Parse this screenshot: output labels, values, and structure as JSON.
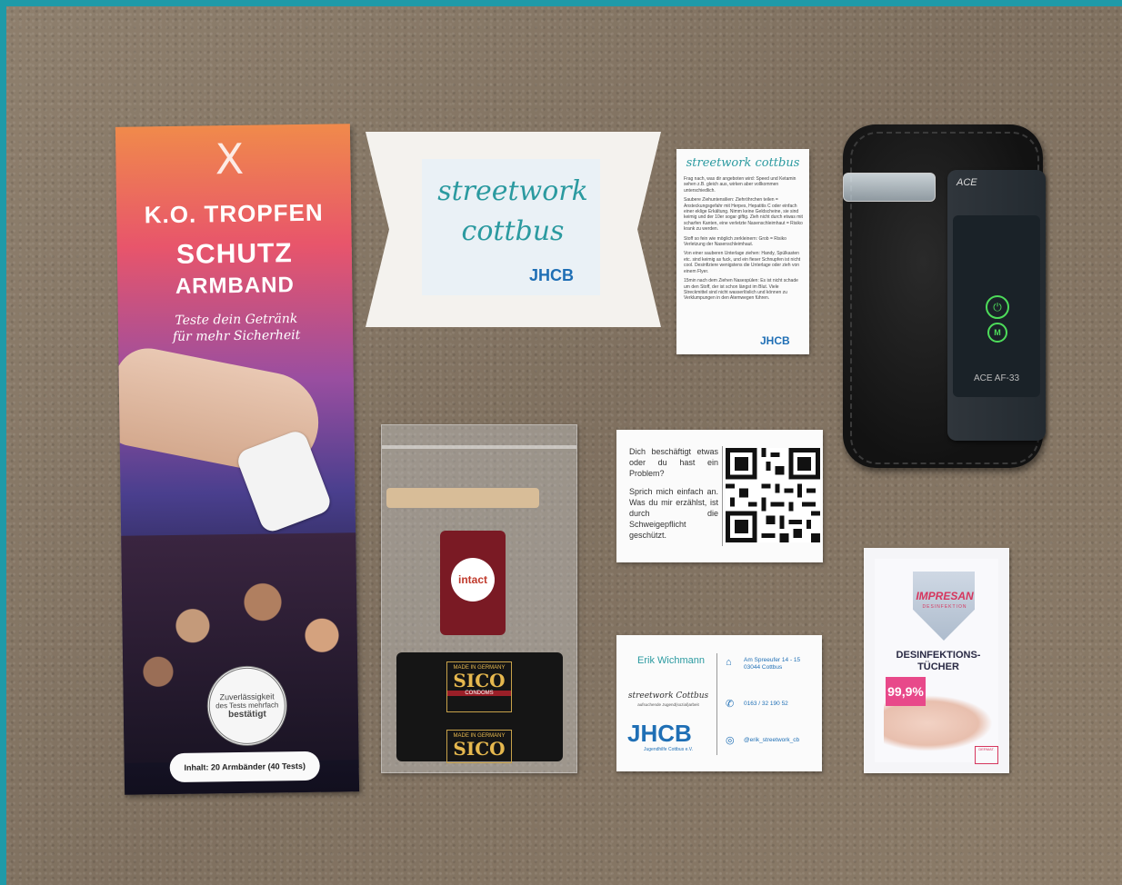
{
  "flyer": {
    "logo": "X",
    "line1": "K.O. TROPFEN",
    "line2": "SCHUTZ",
    "line3": "ARMBAND",
    "tagline1": "Teste dein Getränk",
    "tagline2": "für mehr Sicherheit",
    "seal_line1": "Zuverlässigkeit",
    "seal_line2": "des Tests mehrfach",
    "seal_line3": "bestätigt",
    "content": "Inhalt: 20 Armbänder (40 Tests)"
  },
  "pillow_box": {
    "line1": "streetwork",
    "line2": "cottbus",
    "logo": "JHCB"
  },
  "info_card": {
    "title": "streetwork cottbus",
    "paragraphs": [
      "Frag nach, was dir angeboten wird: Speed und Ketamin sehen z.B. gleich aus, wirken aber vollkommen unterschiedlich.",
      "Saubere Ziehuntensilien: Ziehröhrchen teilen = Ansteckungsgefahr mit Herpes, Hepatitis C oder einfach einer eklige Erkältung. Nimm keine Geldscheine, sie sind keimig und der 10er sogar giftig. Zieh nicht durch etwas mit scharfen Kanten, eine verletzte Nasenschleimhaut = Risiko krank zu werden.",
      "Stoff so fein wie möglich zerkleinern: Grob = Risiko Verletzung der Nasenschleimhaut.",
      "Von einer sauberen Unterlage ziehen: Handy, Spülkasten etc. sind keimig as fuck, und ein fieser Schnupfen ist nicht cool. Desinfiziere wenigstens die Unterlage oder zieh von einem Flyer.",
      "15min nach dem Ziehen Nasespülen: Es ist nicht schade um den Stoff, der ist schon längst im Blut. Viele Streckmittel sind nicht wasserlöslich und können zu Verklumpungen in den Atemwegen führen."
    ],
    "logo": "JHCB"
  },
  "breathalyzer": {
    "brand": "ACE",
    "model": "ACE AF-33",
    "mode_button": "M",
    "power_icon": "power-icon"
  },
  "baggie": {
    "intact_label": "intact",
    "sico_made": "MADE IN GERMANY",
    "sico_name": "SICO",
    "sico_sub": "CONDOMS"
  },
  "qr_card": {
    "text1": "Dich beschäftigt etwas oder du hast ein Problem?",
    "text2": "Sprich mich einfach an. Was du mir erzählst, ist durch die Schweigepflicht geschützt."
  },
  "business_card": {
    "name": "Erik Wichmann",
    "org": "streetwork Cottbus",
    "tagline": "aufsuchende Jugend(sozial)arbeit",
    "logo": "JHCB",
    "logo_sub": "Jugendhilfe Cottbus e.V.",
    "address1": "Am Spreeufer 14 - 15",
    "address2": "03044 Cottbus",
    "phone": "0163 / 32 190 52",
    "instagram": "@erik_streetwork_cb"
  },
  "wipe": {
    "brand": "IMPRESAN",
    "brand_sub": "DESINFEKTION",
    "title1": "DESINFEKTIONS-",
    "title2": "TÜCHER",
    "percent": "99,9%",
    "seal": "DERMAT."
  },
  "colors": {
    "frame": "#1f9aa8",
    "teal_script": "#2b9aa0",
    "jhcb_blue": "#1f6fb5",
    "brand_pink": "#d6365e",
    "led_green": "#4ddc5a"
  }
}
